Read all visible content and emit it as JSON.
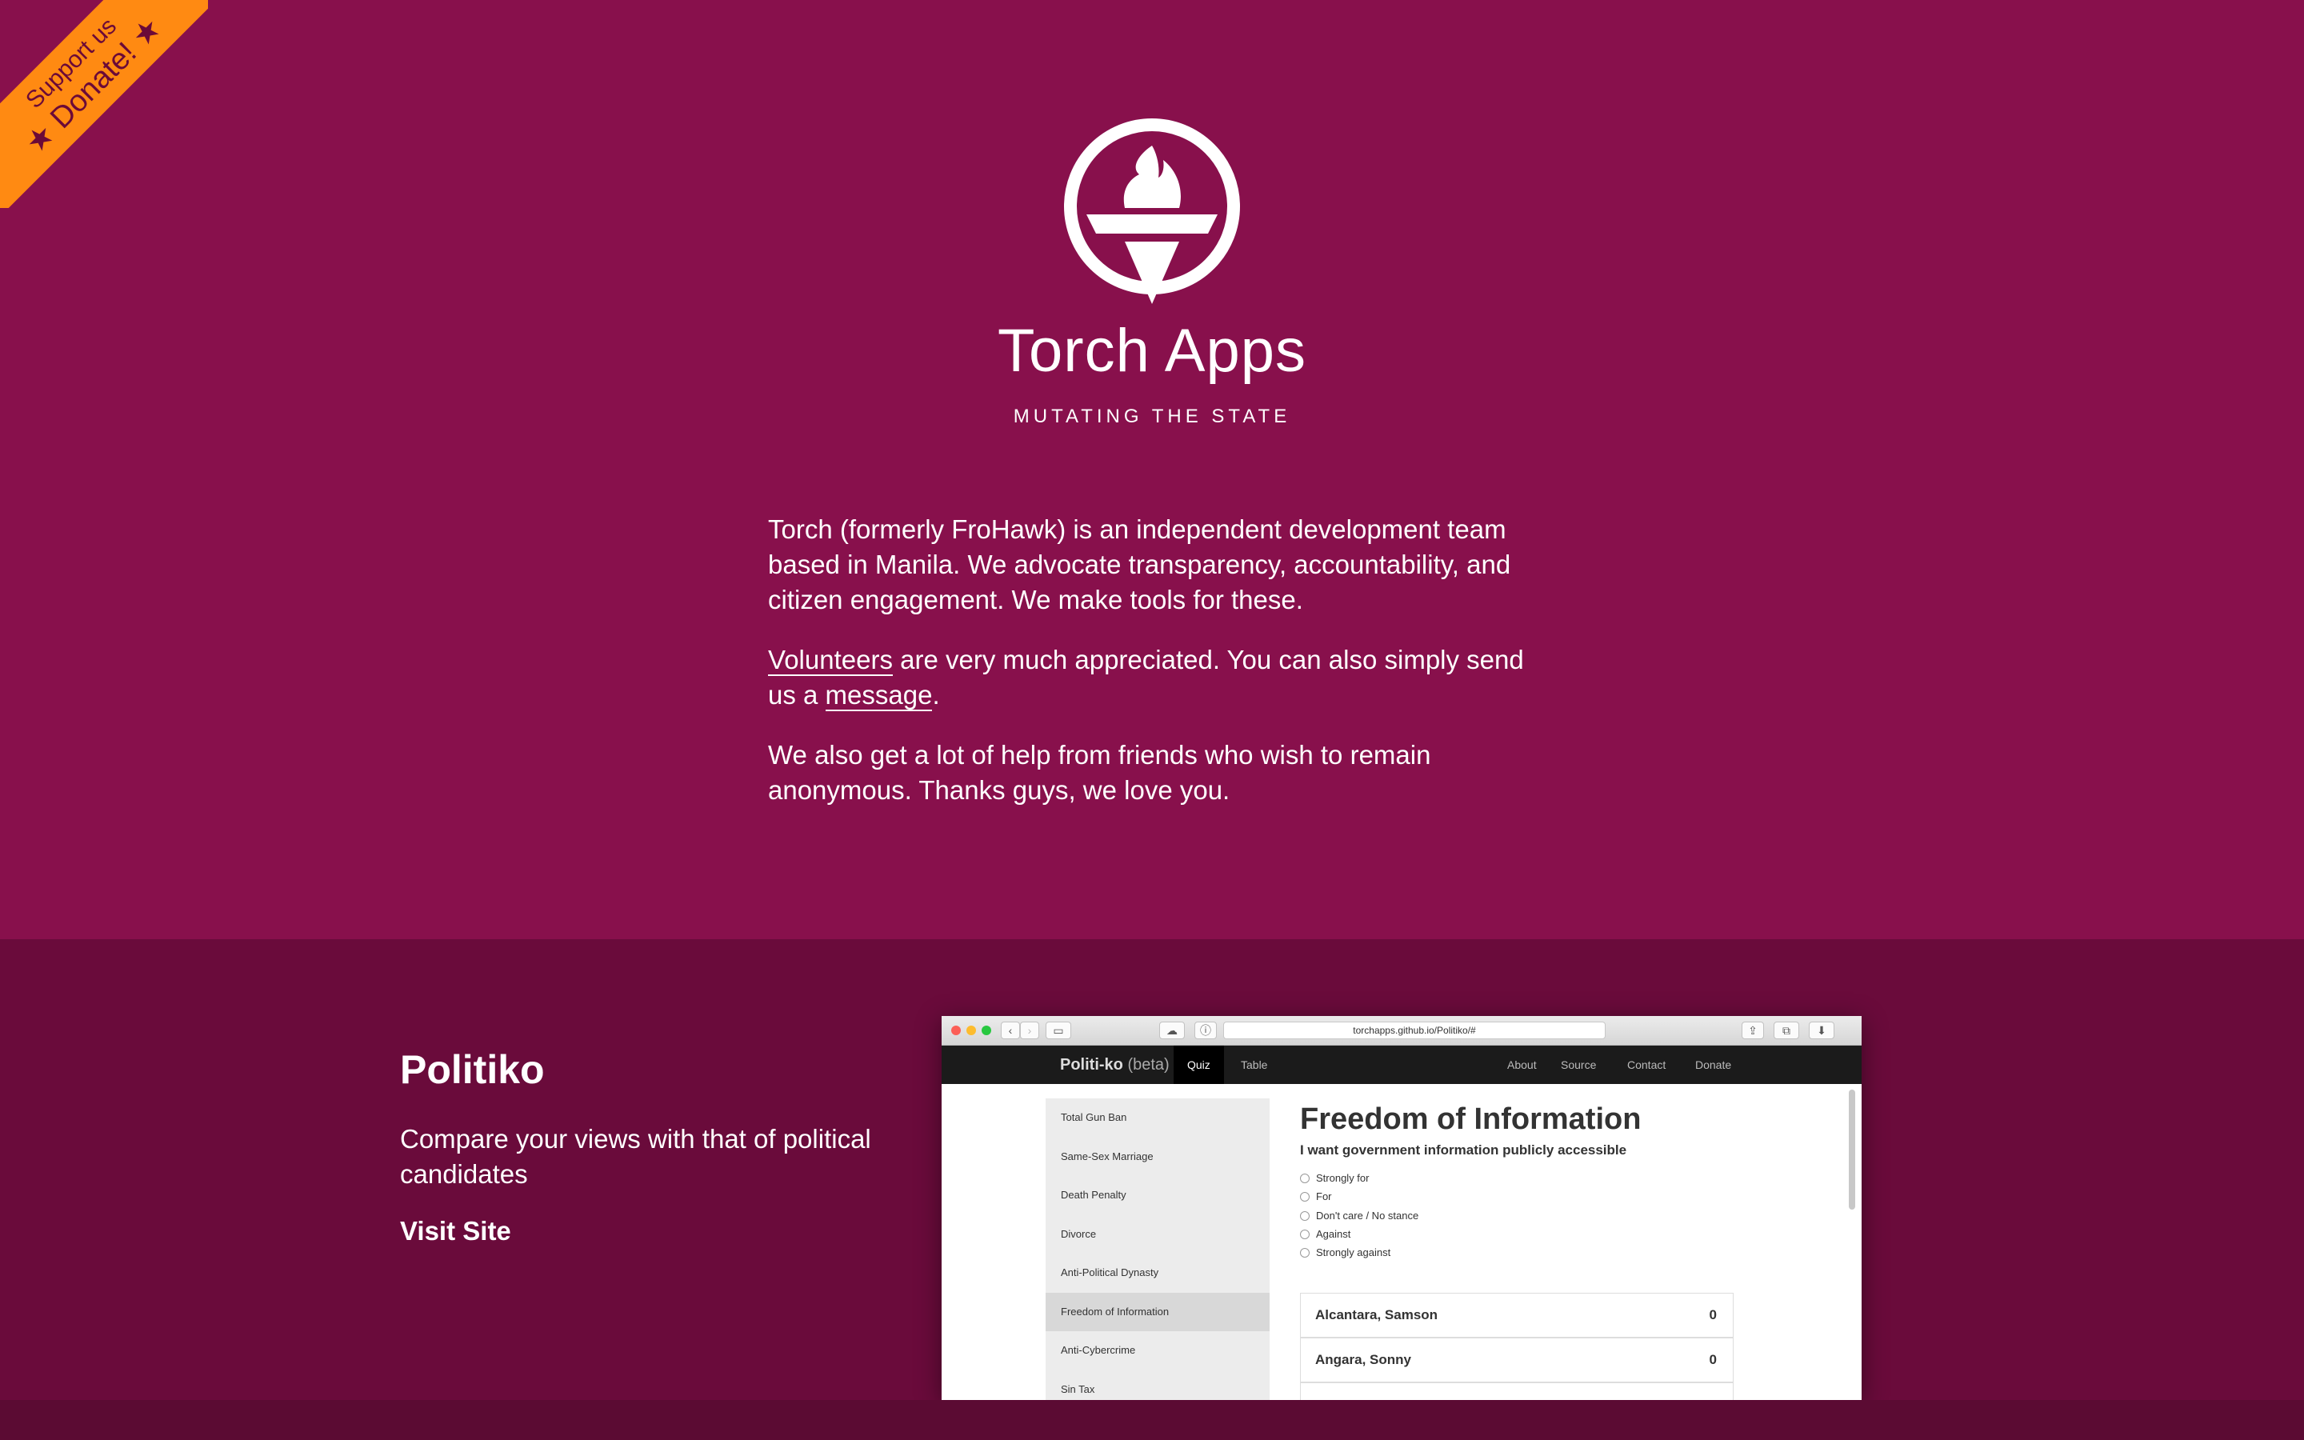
{
  "ribbon": {
    "line1": "Support us",
    "line2": "★ Donate! ★"
  },
  "header": {
    "title": "Torch Apps",
    "tagline": "MUTATING THE STATE"
  },
  "intro": {
    "p1": "Torch (formerly FroHawk) is an independent development team based in Manila. We advocate transparency, accountability, and citizen engagement. We make tools for these.",
    "p2_link1": "Volunteers",
    "p2_mid": " are very much appreciated. You can also simply send us a ",
    "p2_link2": "message",
    "p2_end": ".",
    "p3": "We also get a lot of help from friends who wish to remain anonymous. Thanks guys, we love you."
  },
  "project": {
    "title": "Politiko",
    "description": "Compare your views with that of political candidates",
    "link": "Visit Site"
  },
  "screenshot": {
    "url": "torchapps.github.io/Politiko/#",
    "brand_name": "Politi-ko",
    "brand_suffix": " (beta)",
    "tabs": [
      "Quiz",
      "Table"
    ],
    "nav_right": [
      "About",
      "Source",
      "Contact",
      "Donate"
    ],
    "sidebar": [
      "Total Gun Ban",
      "Same-Sex Marriage",
      "Death Penalty",
      "Divorce",
      "Anti-Political Dynasty",
      "Freedom of Information",
      "Anti-Cybercrime",
      "Sin Tax"
    ],
    "heading": "Freedom of Information",
    "subheading": "I want government information publicly accessible",
    "options": [
      "Strongly for",
      "For",
      "Don't care / No stance",
      "Against",
      "Strongly against"
    ],
    "candidates": [
      {
        "name": "Alcantara, Samson",
        "score": "0"
      },
      {
        "name": "Angara, Sonny",
        "score": "0"
      }
    ]
  },
  "colors": {
    "hero_bg": "#88104c",
    "project_bg": "#6a0b3b",
    "ribbon": "#ff8a12"
  }
}
